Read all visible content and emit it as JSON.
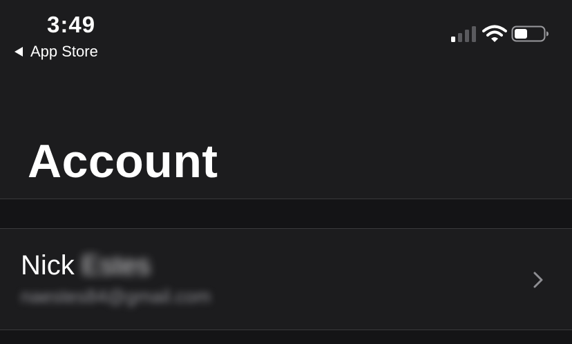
{
  "status_bar": {
    "time": "3:49",
    "back_label": "App Store",
    "signal_icon": "cellular-signal-icon",
    "wifi_icon": "wifi-icon",
    "battery_icon": "battery-icon",
    "signal_bars_filled": 1,
    "signal_bars_total": 4,
    "battery_level": 0.45
  },
  "header": {
    "title": "Account"
  },
  "account": {
    "first_name": "Nick",
    "last_name": "Estes",
    "email": "naestes84@gmail.com",
    "chevron_icon": "chevron-right-icon"
  },
  "colors": {
    "background": "#1c1c1e",
    "section_gap": "#141416",
    "separator": "#3a3a3c",
    "secondary_text": "#8e8e93",
    "chevron": "#8e8e93"
  }
}
